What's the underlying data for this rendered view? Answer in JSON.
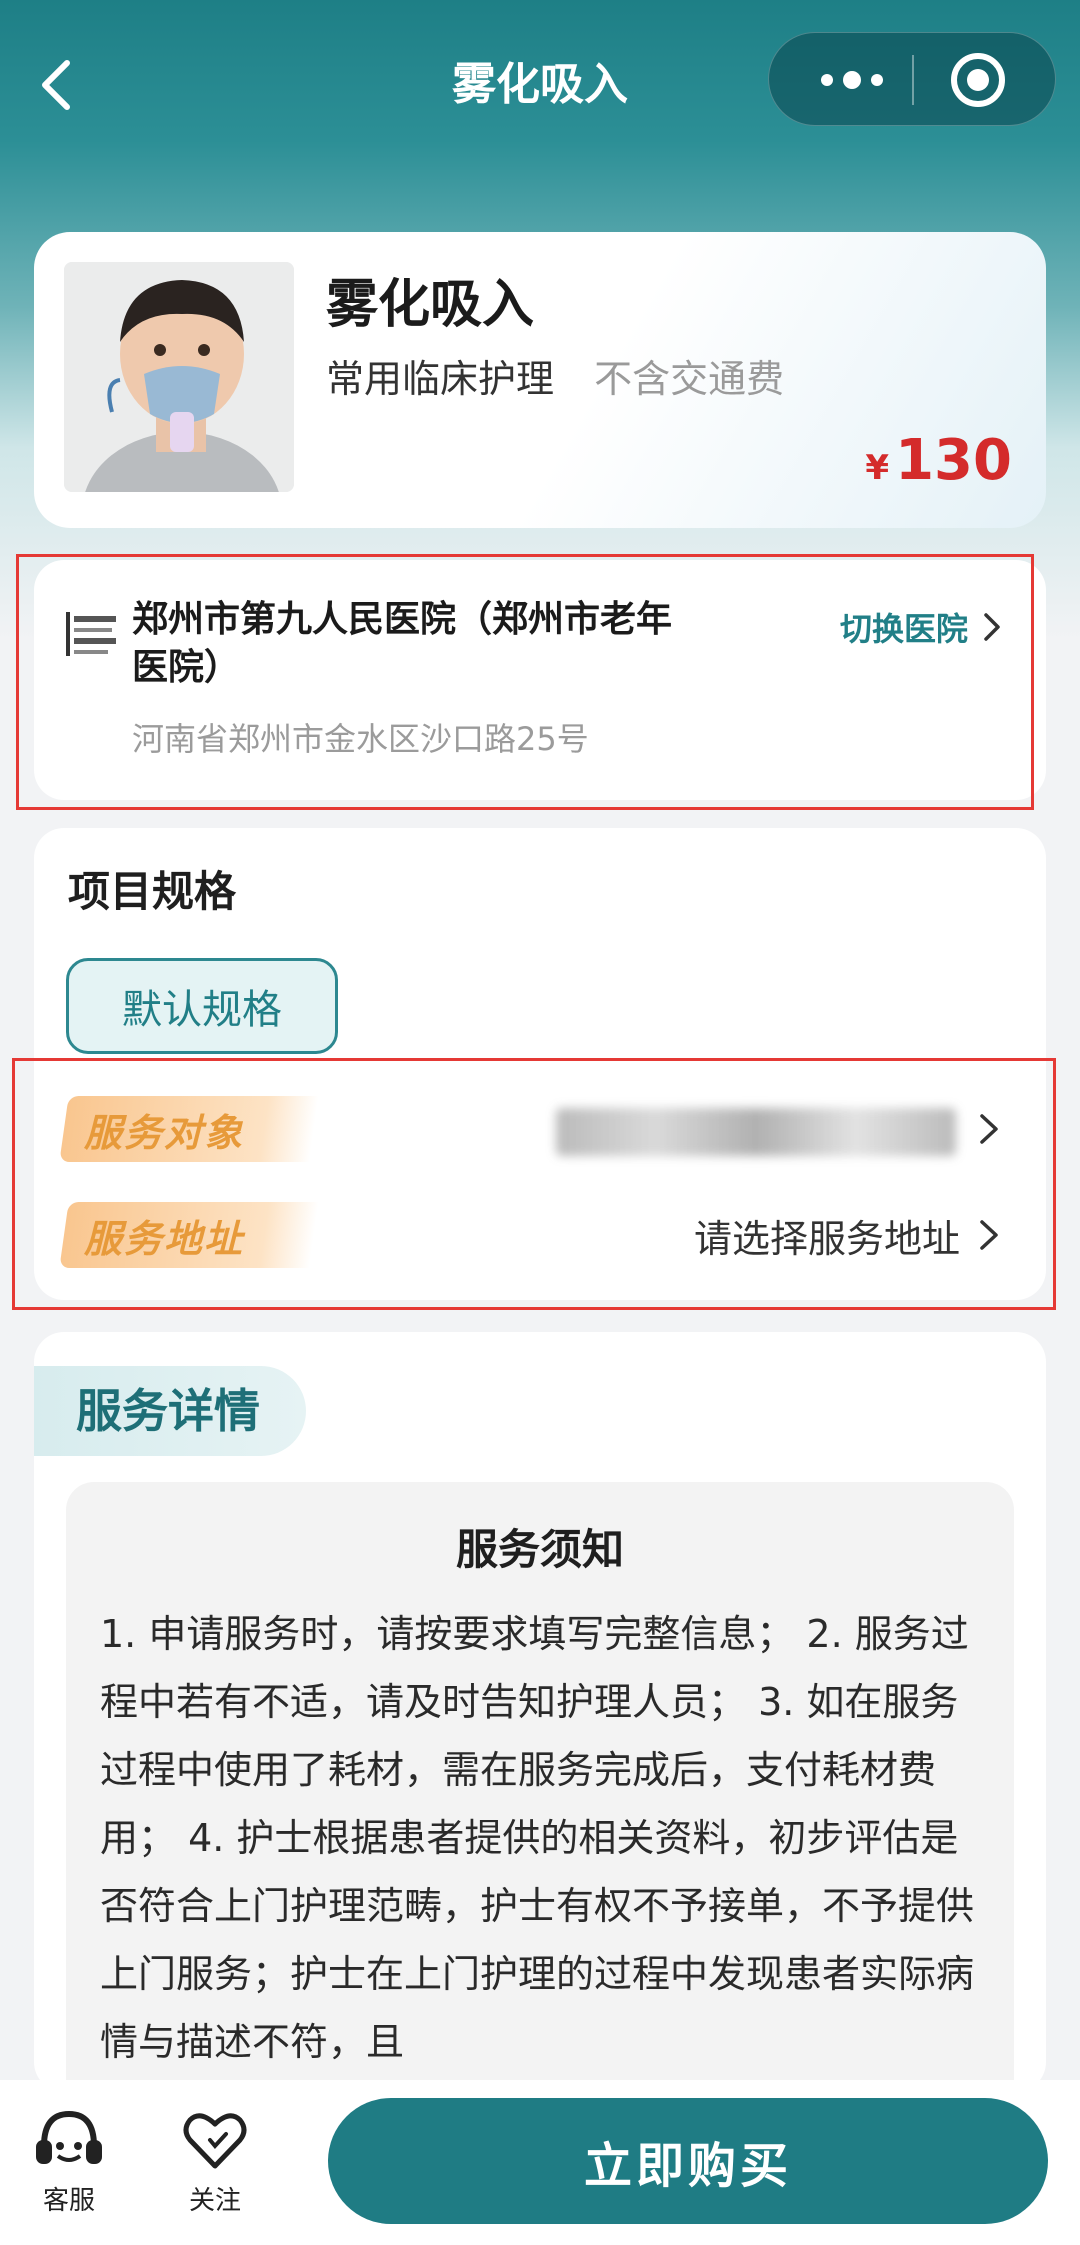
{
  "nav": {
    "title": "雾化吸入"
  },
  "product": {
    "name": "雾化吸入",
    "tag_category": "常用临床护理",
    "tag_note": "不含交通费",
    "currency": "¥",
    "price": "130",
    "image_icon": "child-nebulizer-photo"
  },
  "hospital": {
    "name": "郑州市第九人民医院（郑州市老年医院）",
    "switch_label": "切换医院",
    "address": "河南省郑州市金水区沙口路25号",
    "logo_text": "郑州市第九人民医院"
  },
  "spec": {
    "title": "项目规格",
    "option": "默认规格",
    "service_target_label": "服务对象",
    "service_address_label": "服务地址",
    "service_address_value": "请选择服务地址"
  },
  "detail": {
    "tab_label": "服务详情",
    "notice_title": "服务须知",
    "notice_body": "1.  申请服务时，请按要求填写完整信息；  2.  服务过程中若有不适，请及时告知护理人员；  3.  如在服务过程中使用了耗材，需在服务完成后，支付耗材费用；  4.  护士根据患者提供的相关资料，初步评估是否符合上门护理范畴，护士有权不予接单，不予提供上门服务；护士在上门护理的过程中发现患者实际病情与描述不符，且"
  },
  "bottom": {
    "service_label": "客服",
    "follow_label": "关注",
    "buy_label": "立即购买"
  },
  "colors": {
    "brand": "#1f7c84",
    "price": "#d42b2b",
    "badge": "#e79a3a",
    "highlight_box": "#e53935"
  }
}
